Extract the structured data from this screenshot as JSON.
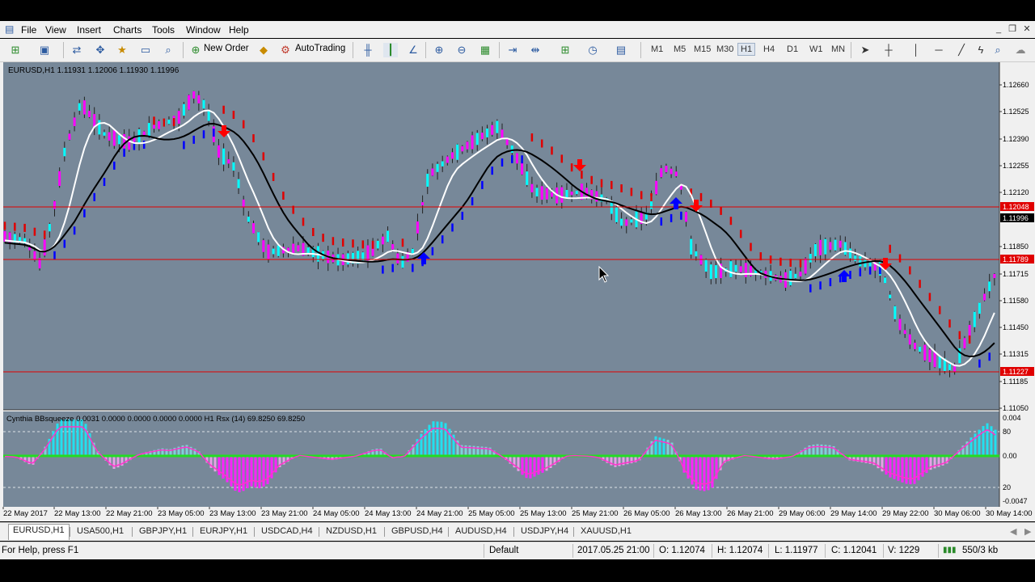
{
  "menu": {
    "items": [
      {
        "label": "File"
      },
      {
        "label": "View"
      },
      {
        "label": "Insert"
      },
      {
        "label": "Charts"
      },
      {
        "label": "Tools"
      },
      {
        "label": "Window"
      },
      {
        "label": "Help"
      }
    ]
  },
  "toolbar": {
    "new_order_label": "New Order",
    "autotrading_label": "AutoTrading",
    "timeframes": [
      "M1",
      "M5",
      "M15",
      "M30",
      "H1",
      "H4",
      "D1",
      "W1",
      "MN"
    ],
    "active_timeframe": "H1"
  },
  "chart": {
    "header": "EURUSD,H1  1.11931 1.12006 1.11930 1.11996",
    "indicator_header": "Cynthia BBsqueeze 0.0031 0.0000 0.0000 0.0000 0.0000  H1  Rsx (14) 69.8250 69.8250",
    "price_labels": [
      "1.12660",
      "1.12525",
      "1.12390",
      "1.12255",
      "1.12120",
      "1.11850",
      "1.11715",
      "1.11580",
      "1.11450",
      "1.11315",
      "1.11185",
      "1.11050"
    ],
    "current_price": "1.11996",
    "hline_labels": [
      "1.12048",
      "1.11789",
      "1.11227"
    ],
    "indicator_labels": [
      "0.004",
      "80",
      "0.00",
      "20",
      "-0.0047"
    ],
    "time_labels": [
      "22 May 2017",
      "22 May 13:00",
      "22 May 21:00",
      "23 May 05:00",
      "23 May 13:00",
      "23 May 21:00",
      "24 May 05:00",
      "24 May 13:00",
      "24 May 21:00",
      "25 May 05:00",
      "25 May 13:00",
      "25 May 21:00",
      "26 May 05:00",
      "26 May 13:00",
      "26 May 21:00",
      "29 May 06:00",
      "29 May 14:00",
      "29 May 22:00",
      "30 May 06:00",
      "30 May 14:00"
    ],
    "colors": {
      "background": "#778899",
      "bull": "#00ffff",
      "bear": "#ff00ff",
      "hline": "#e00000",
      "buy_arrow": "#0000ff",
      "sell_arrow": "#ff0000"
    }
  },
  "tabs": [
    "EURUSD,H1",
    "USA500,H1",
    "GBPJPY,H1",
    "EURJPY,H1",
    "USDCAD,H4",
    "NZDUSD,H1",
    "GBPUSD,H4",
    "AUDUSD,H4",
    "USDJPY,H4",
    "XAUUSD,H1"
  ],
  "active_tab": "EURUSD,H1",
  "status": {
    "help": "For Help, press F1",
    "profile": "Default",
    "datetime": "2017.05.25 21:00",
    "open": "O: 1.12074",
    "high": "H: 1.12074",
    "low": "L: 1.11977",
    "close": "C: 1.12041",
    "volume": "V: 1229",
    "traffic": "550/3 kb"
  }
}
